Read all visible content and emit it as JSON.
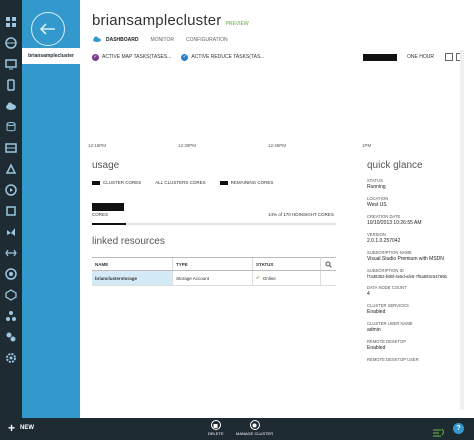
{
  "side_panel": {
    "selected_item": "briansamplecluster"
  },
  "header": {
    "title": "briansamplecluster",
    "badge": "PREVIEW"
  },
  "tabs": [
    {
      "label": "DASHBOARD",
      "active": true
    },
    {
      "label": "MONITOR",
      "active": false
    },
    {
      "label": "CONFIGURATION",
      "active": false
    }
  ],
  "metrics": [
    {
      "label": "ACTIVE MAP TASKS(TASES...",
      "color": "#7a3b8f"
    },
    {
      "label": "ACTIVE REDUCE TASKS(TAS...",
      "color": "#2a7fc8"
    }
  ],
  "time_range": {
    "label": "ONE HOUR"
  },
  "chart_data": {
    "type": "line",
    "x": [
      "12:15PM",
      "12:30PM",
      "12:45PM",
      "1PM"
    ],
    "series": []
  },
  "usage": {
    "title": "usage",
    "legend": [
      {
        "label": "CLUSTER CORES",
        "color": "#111111"
      },
      {
        "label": "ALL CLUSTERS CORES",
        "color": "#ffffff"
      },
      {
        "label": "REMAINING CORES",
        "color": "#111111"
      }
    ],
    "cores_label": "CORES",
    "cores_summary": "14% of 170 HDINSIGHT CORES",
    "cores_percent": 14
  },
  "linked": {
    "title": "linked resources",
    "headers": {
      "name": "NAME",
      "type": "TYPE",
      "status": "STATUS"
    },
    "rows": [
      {
        "name": "brianclusterstorage",
        "type": "Storage Account",
        "status": "Online"
      }
    ]
  },
  "quick_glance": {
    "title": "quick glance",
    "items": [
      {
        "label": "STATUS",
        "value": "Running"
      },
      {
        "label": "LOCATION",
        "value": "West US"
      },
      {
        "label": "CREATION DATE",
        "value": "10/10/2013 10:26:55 AM"
      },
      {
        "label": "VERSION",
        "value": "2.0.1.0.257042"
      },
      {
        "label": "SUBSCRIPTION NAME",
        "value": "Visual Studio Premium with MSDN"
      },
      {
        "label": "SUBSCRIPTION ID",
        "value": "f7a38352-b9bf-4e5d-afe5-7f6a893c54766b"
      },
      {
        "label": "DATA NODE COUNT",
        "value": "4"
      },
      {
        "label": "CLUSTER SERVICES",
        "value": "Enabled"
      },
      {
        "label": "CLUSTER USER NAME",
        "value": "admin"
      },
      {
        "label": "REMOTE DESKTOP",
        "value": "Enabled"
      },
      {
        "label": "REMOTE DESKTOP USER",
        "value": ""
      }
    ]
  },
  "commands": {
    "new_label": "NEW",
    "delete_label": "DELETE",
    "manage_label": "MANAGE CLUSTER",
    "help_label": "?"
  },
  "nav_icons": [
    "all-items-icon",
    "web-sites-icon",
    "virtual-machines-icon",
    "mobile-services-icon",
    "cloud-services-icon",
    "sql-databases-icon",
    "storage-icon",
    "hdinsight-icon",
    "media-services-icon",
    "service-bus-icon",
    "visual-studio-icon",
    "cache-icon",
    "biztalk-icon",
    "recovery-services-icon",
    "networks-icon",
    "traffic-manager-icon",
    "active-directory-icon",
    "add-ons-icon",
    "settings-icon"
  ]
}
